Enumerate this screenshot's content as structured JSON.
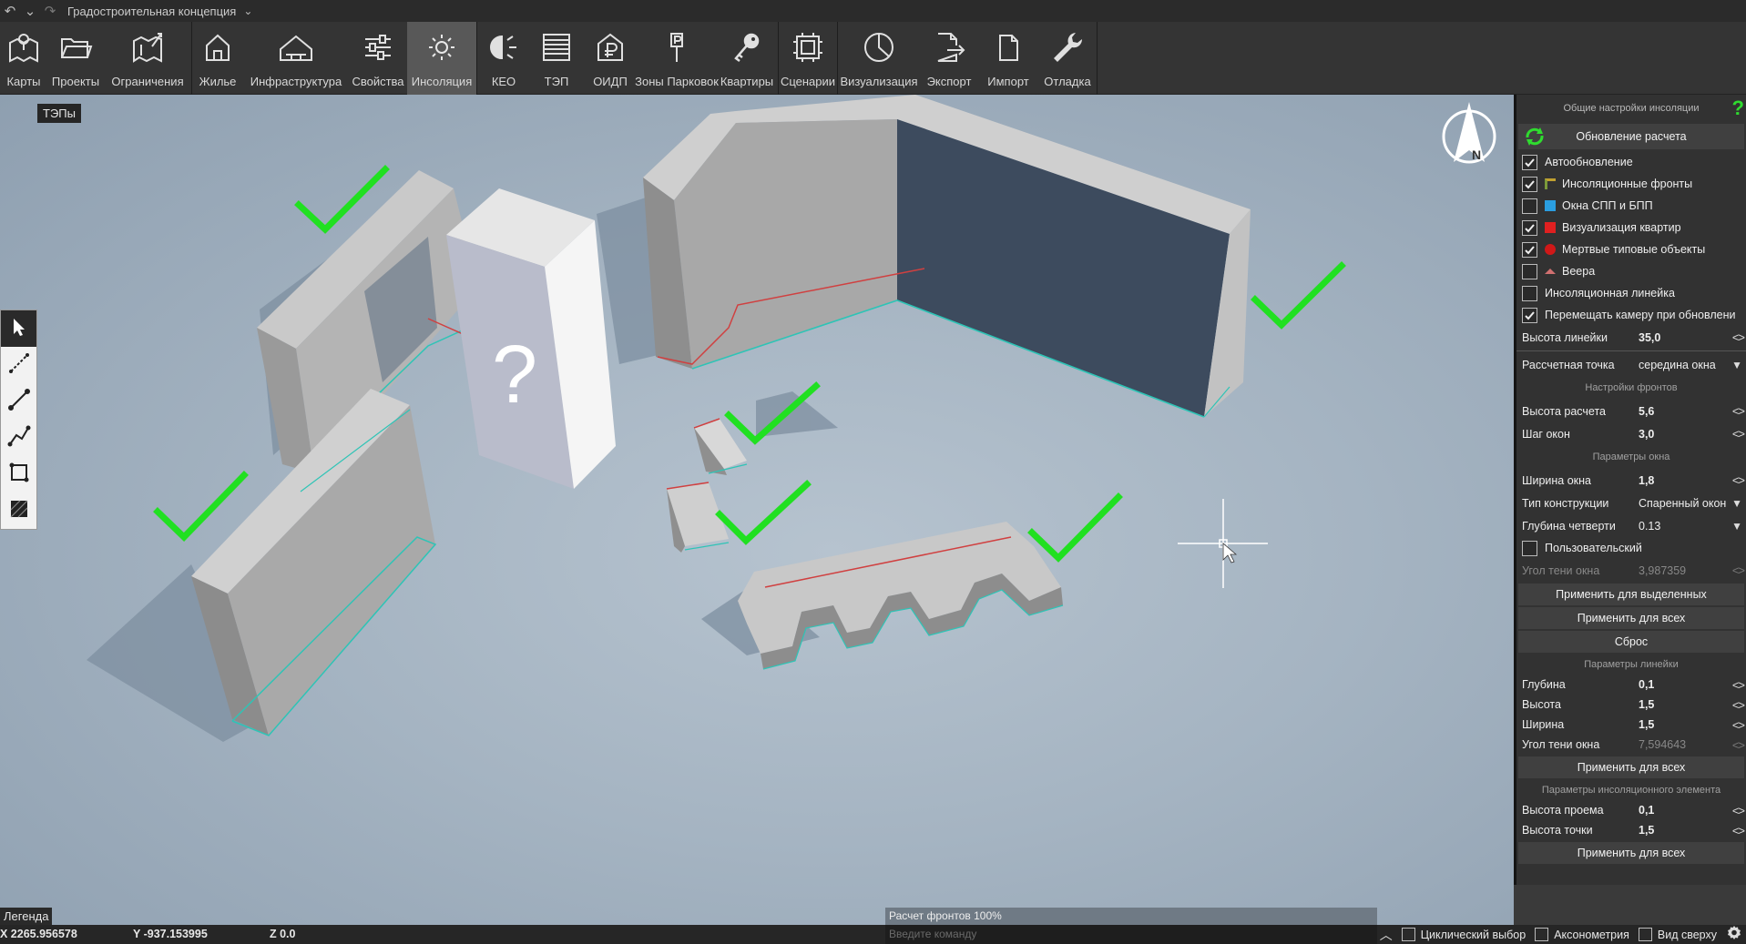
{
  "titlebar": {
    "title": "Градостроительная концепция"
  },
  "toolbar": {
    "tools": [
      {
        "label": "Карты",
        "icon": "map-pin-icon"
      },
      {
        "label": "Проекты",
        "icon": "folder-icon"
      },
      {
        "label": "Ограничения",
        "icon": "restriction-map-icon"
      },
      {
        "label": "Жилье",
        "icon": "house-icon"
      },
      {
        "label": "Инфраструктура",
        "icon": "infrastructure-icon"
      },
      {
        "label": "Свойства",
        "icon": "sliders-icon"
      },
      {
        "label": "Инсоляция",
        "icon": "sun-icon"
      },
      {
        "label": "КЕО",
        "icon": "keo-icon"
      },
      {
        "label": "ТЭП",
        "icon": "table-icon"
      },
      {
        "label": "ОИДП",
        "icon": "ruble-house-icon"
      },
      {
        "label": "Зоны Парковок",
        "icon": "parking-sign-icon"
      },
      {
        "label": "Квартиры",
        "icon": "key-icon"
      },
      {
        "label": "Сценарии",
        "icon": "scenario-icon"
      },
      {
        "label": "Визуализация",
        "icon": "pie-chart-icon"
      },
      {
        "label": "Экспорт",
        "icon": "export-icon"
      },
      {
        "label": "Импорт",
        "icon": "import-icon"
      },
      {
        "label": "Отладка",
        "icon": "wrench-icon"
      }
    ],
    "active": "Инсоляция"
  },
  "viewport": {
    "teps_badge": "ТЭПы",
    "question_mark": "?",
    "legend": "Легенда",
    "progress_text": "Расчет фронтов 100%"
  },
  "panel": {
    "header": "Общие настройки инсоляции",
    "help": "?",
    "update_button": "Обновление расчета",
    "checks": [
      {
        "label": "Автообновление",
        "checked": true,
        "swatch": ""
      },
      {
        "label": "Инсоляционные фронты",
        "checked": true,
        "swatch": "#7a9a3a"
      },
      {
        "label": "Окна СПП и БПП",
        "checked": false,
        "swatch": "#2a9ee0"
      },
      {
        "label": "Визуализация квартир",
        "checked": true,
        "swatch": "#e02020"
      },
      {
        "label": "Мертвые типовые объекты",
        "checked": true,
        "swatch": "#d01818"
      },
      {
        "label": "Веера",
        "checked": false,
        "swatch": "#d07070"
      },
      {
        "label": "Инсоляционная линейка",
        "checked": false,
        "swatch": ""
      },
      {
        "label": "Перемещать камеру при обновлени",
        "checked": true,
        "swatch": ""
      }
    ],
    "ruler_height": {
      "label": "Высота линейки",
      "value": "35,0"
    },
    "calc_point": {
      "label": "Рассчетная точка",
      "value": "середина окна"
    },
    "fronts_header": "Настройки фронтов",
    "calc_height": {
      "label": "Высота расчета",
      "value": "5,6"
    },
    "window_step": {
      "label": "Шаг окон",
      "value": "3,0"
    },
    "window_params_header": "Параметры окна",
    "window_width": {
      "label": "Ширина окна",
      "value": "1,8"
    },
    "construction_type": {
      "label": "Тип конструкции",
      "value": "Спаренный окон"
    },
    "quarter_depth": {
      "label": "Глубина четверти",
      "value": "0.13"
    },
    "custom": {
      "label": "Пользовательский",
      "checked": false
    },
    "shadow_angle": {
      "label": "Угол тени окна",
      "value": "3,987359"
    },
    "apply_selected": "Применить для выделенных",
    "apply_all_1": "Применить для всех",
    "reset": "Сброс",
    "ruler_params_header": "Параметры линейки",
    "depth": {
      "label": "Глубина",
      "value": "0,1"
    },
    "height": {
      "label": "Высота",
      "value": "1,5"
    },
    "width": {
      "label": "Ширина",
      "value": "1,5"
    },
    "shadow_angle_2": {
      "label": "Угол тени окна",
      "value": "7,594643"
    },
    "apply_all_2": "Применить для всех",
    "insol_element_header": "Параметры инсоляционного элемента",
    "opening_height": {
      "label": "Высота проема",
      "value": "0,1"
    },
    "point_height": {
      "label": "Высота точки",
      "value": "1,5"
    },
    "apply_all_3": "Применить для всех"
  },
  "status": {
    "x": "X 2265.956578",
    "y": "Y -937.153995",
    "z": "Z 0.0",
    "command_placeholder": "Введите команду",
    "options": [
      {
        "label": "Циклический выбор",
        "checked": false
      },
      {
        "label": "Аксонометрия",
        "checked": false
      },
      {
        "label": "Вид сверху",
        "checked": false
      }
    ]
  }
}
